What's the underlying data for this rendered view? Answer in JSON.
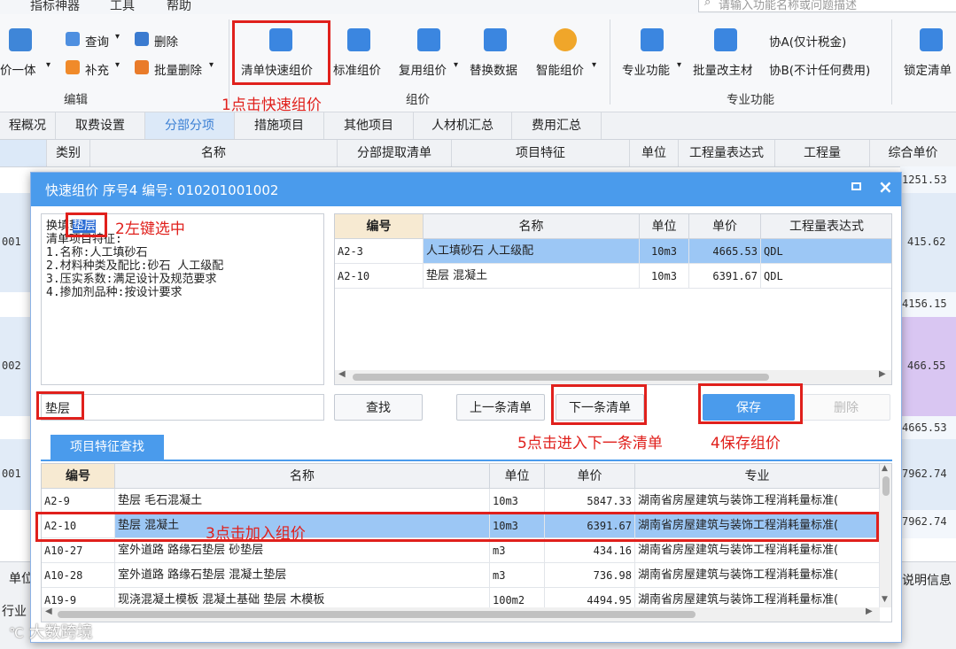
{
  "menu": {
    "items": [
      "指标神器",
      "工具",
      "帮助"
    ],
    "search_placeholder": "请输入功能名称或问题描述"
  },
  "ribbon": {
    "edit": {
      "partial_left": "价一体",
      "query": "查询",
      "delete": "删除",
      "supplement": "补充",
      "batch_delete": "批量删除",
      "group_label": "编辑"
    },
    "compose": {
      "quick": "清单快速组价",
      "standard": "标准组价",
      "reuse": "复用组价",
      "replace": "替换数据",
      "smart": "智能组价",
      "group_label": "组价"
    },
    "pro": {
      "special": "专业功能",
      "batch_material": "批量改主材",
      "assoc_a": "协A(仅计税金)",
      "assoc_b": "协B(不计任何费用)",
      "group_label": "专业功能"
    },
    "lock": "锁定清单"
  },
  "tabs": [
    "程概况",
    "取费设置",
    "分部分项",
    "措施项目",
    "其他项目",
    "人材机汇总",
    "费用汇总"
  ],
  "grid": {
    "headers": [
      "类别",
      "名称",
      "分部提取清单",
      "项目特征",
      "单位",
      "工程量表达式",
      "工程量",
      "综合单价"
    ],
    "left_codes": [
      "001",
      "002",
      "001"
    ],
    "right_values": [
      "1251.53",
      "415.62",
      "4156.15",
      "466.55",
      "4665.53",
      "7962.74",
      "7962.74"
    ],
    "bottom_left": [
      "单位",
      "行业"
    ],
    "bottom_right": "说明信息"
  },
  "dialog": {
    "title": "快速组价 序号4 编号: 010201001002",
    "spec_text": [
      "换填垫层",
      "清单项目特征:",
      "1.名称:人工填砂石",
      "2.材料种类及配比:砂石 人工级配",
      "3.压实系数:满足设计及规范要求",
      "4.掺加剂品种:按设计要求"
    ],
    "selected_word": "垫层",
    "top_table": {
      "headers": [
        "编号",
        "名称",
        "单位",
        "单价",
        "工程量表达式"
      ],
      "rows": [
        [
          "A2-3",
          "人工填砂石 人工级配",
          "10m3",
          "4665.53",
          "QDL"
        ],
        [
          "A2-10",
          "垫层 混凝土",
          "10m3",
          "6391.67",
          "QDL"
        ]
      ]
    },
    "search_value": "垫层",
    "buttons": {
      "find": "查找",
      "prev": "上一条清单",
      "next": "下一条清单",
      "save": "保存",
      "delete": "删除"
    },
    "spec_search_tab": "项目特征查找",
    "bottom_table": {
      "headers": [
        "编号",
        "名称",
        "单位",
        "单价",
        "专业"
      ],
      "rows": [
        [
          "A2-9",
          "垫层 毛石混凝土",
          "10m3",
          "5847.33",
          "湖南省房屋建筑与装饰工程消耗量标准("
        ],
        [
          "A2-10",
          "垫层 混凝土",
          "10m3",
          "6391.67",
          "湖南省房屋建筑与装饰工程消耗量标准("
        ],
        [
          "A10-27",
          "室外道路 路缘石垫层 砂垫层",
          "m3",
          "434.16",
          "湖南省房屋建筑与装饰工程消耗量标准("
        ],
        [
          "A10-28",
          "室外道路 路缘石垫层 混凝土垫层",
          "m3",
          "736.98",
          "湖南省房屋建筑与装饰工程消耗量标准("
        ],
        [
          "A19-9",
          "现浇混凝土模板 混凝土基础 垫层 木模板",
          "100m2",
          "4494.95",
          "湖南省房屋建筑与装饰工程消耗量标准("
        ]
      ]
    }
  },
  "annotations": {
    "a1": "1点击快速组价",
    "a2": "2左键选中",
    "a3": "3点击加入组价",
    "a4": "4保存组价",
    "a5": "5点击进入下一条清单"
  },
  "watermark": "大数跨境",
  "colors": {
    "accent": "#4a9bec",
    "selected_row": "#9cc7f5",
    "annotation": "#e0201c"
  }
}
